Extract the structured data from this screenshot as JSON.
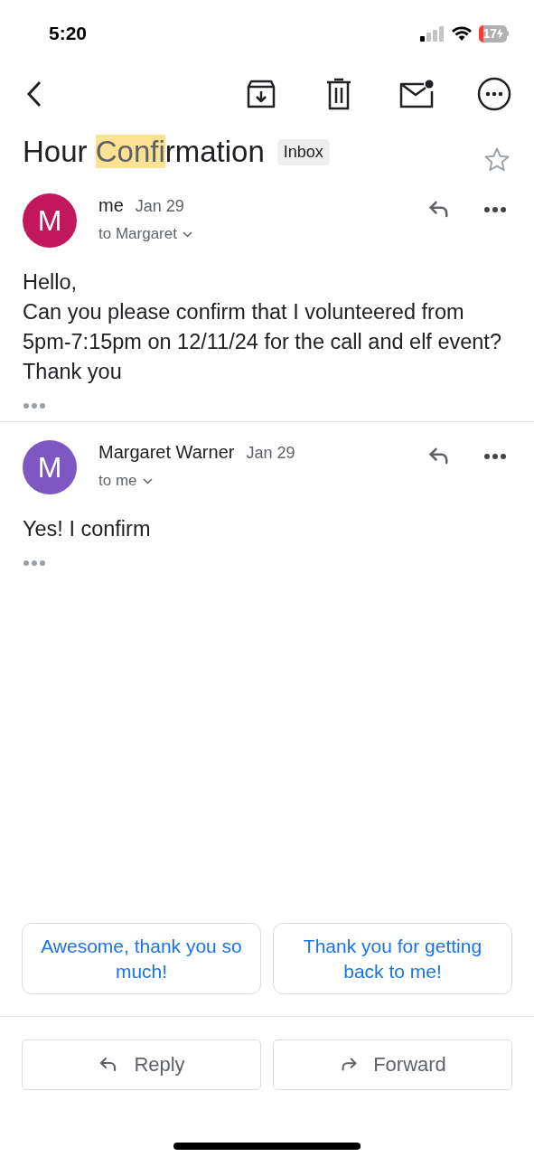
{
  "status_bar": {
    "time": "5:20",
    "battery": "17"
  },
  "subject": {
    "parts": [
      {
        "text": "Hour ",
        "highlighted": false
      },
      {
        "text": "Confi",
        "highlighted": true
      },
      {
        "text": "rmation",
        "highlighted": false
      }
    ],
    "label": "Inbox",
    "starred": false
  },
  "messages": [
    {
      "avatar": "M",
      "color": "#c2185b",
      "sender": "me",
      "date": "Jan 29",
      "recipient": "to Margaret",
      "body": [
        "Hello,",
        "Can you please confirm that I volunteered from 5pm-7:15pm on 12/11/24 for the call and elf event?",
        "Thank you"
      ]
    },
    {
      "avatar": "M",
      "color": "#7e57c2",
      "sender": "Margaret Warner",
      "date": "Jan 29",
      "recipient": "to me",
      "body": [
        "Yes! I confirm"
      ]
    }
  ],
  "smart_replies": [
    "Awesome, thank you so much!",
    "Thank you for getting back to me!"
  ],
  "actions": [
    {
      "kind": "reply",
      "label": "Reply"
    },
    {
      "kind": "forward",
      "label": "Forward"
    }
  ]
}
